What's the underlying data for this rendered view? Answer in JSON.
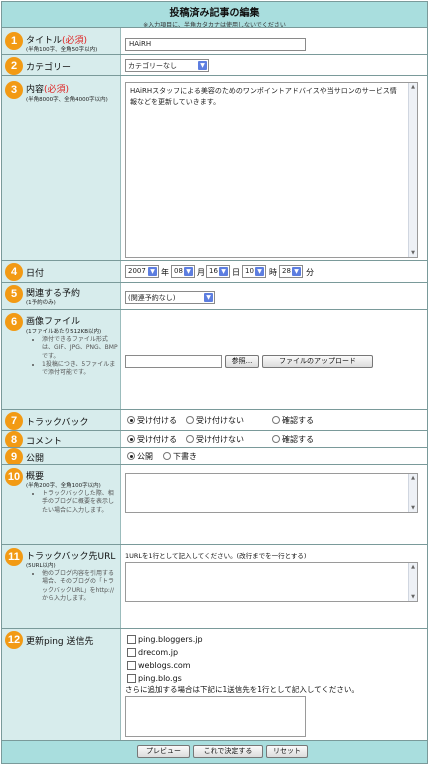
{
  "header": {
    "title": "投稿済み記事の編集",
    "subtitle": "※入力項目に、半角カタカナは使用しないでください"
  },
  "fields": {
    "title": {
      "num": "1",
      "label": "タイトル",
      "req": "(必須)",
      "sub": "(半角100字、全角50字以内)",
      "value": "HAiRH"
    },
    "category": {
      "num": "2",
      "label": "カテゴリー",
      "value": "カテゴリーなし"
    },
    "content": {
      "num": "3",
      "label": "内容",
      "req": "(必須)",
      "sub": "(半角8000字、全角4000字以内)",
      "value": "HAiRHスタッフによる美容のためのワンポイントアドバイスや当サロンのサービス情報などを更新していきます。"
    },
    "date": {
      "num": "4",
      "label": "日付",
      "year": "2007",
      "year_unit": "年",
      "month": "08",
      "month_unit": "月",
      "day": "16",
      "day_unit": "日",
      "hour": "10",
      "hour_unit": "時",
      "minute": "28",
      "minute_unit": "分"
    },
    "reservation": {
      "num": "5",
      "label": "関連する予約",
      "sub": "(1予約のみ)",
      "value": "(関連予約なし)"
    },
    "image": {
      "num": "6",
      "label": "画像ファイル",
      "sub": "(1ファイルあたり512KB以内)",
      "notes": [
        "添付できるファイル形式は、GIF、JPG、PNG、BMPです。",
        "1投稿につき、5ファイルまで添付可能です。"
      ],
      "browse_label": "参照...",
      "upload_label": "ファイルのアップロード"
    },
    "trackback": {
      "num": "7",
      "label": "トラックバック",
      "options": [
        "受け付ける",
        "受け付けない",
        "確認する"
      ]
    },
    "comment": {
      "num": "8",
      "label": "コメント",
      "options": [
        "受け付ける",
        "受け付けない",
        "確認する"
      ]
    },
    "publish": {
      "num": "9",
      "label": "公開",
      "options": [
        "公開",
        "下書き"
      ]
    },
    "summary": {
      "num": "10",
      "label": "概要",
      "sub": "(半角200字、全角100字以内)",
      "notes": [
        "トラックバックした際、相手のブログに概要を表示したい場合に入力します。"
      ]
    },
    "trackback_url": {
      "num": "11",
      "label": "トラックバック先URL",
      "sub": "(5URL以内)",
      "notes": [
        "他のブログ内容を引用する場合、そのブログの「トラックバックURL」をhttp://から入力します。"
      ],
      "instruction": "1URLを1行として記入してください。(改行までを一行とする)"
    },
    "ping": {
      "num": "12",
      "label": "更新ping 送信先",
      "servers": [
        "ping.bloggers.jp",
        "drecom.jp",
        "weblogs.com",
        "ping.blo.gs"
      ],
      "instruction": "さらに追加する場合は下記に1送信先を1行として記入してください。"
    }
  },
  "footer": {
    "preview": "プレビュー",
    "submit": "これで決定する",
    "reset": "リセット"
  },
  "colors": {
    "accent": "#a9dede",
    "label_bg": "#d7ecec",
    "badge": "#f29a14",
    "required": "#e02020"
  }
}
